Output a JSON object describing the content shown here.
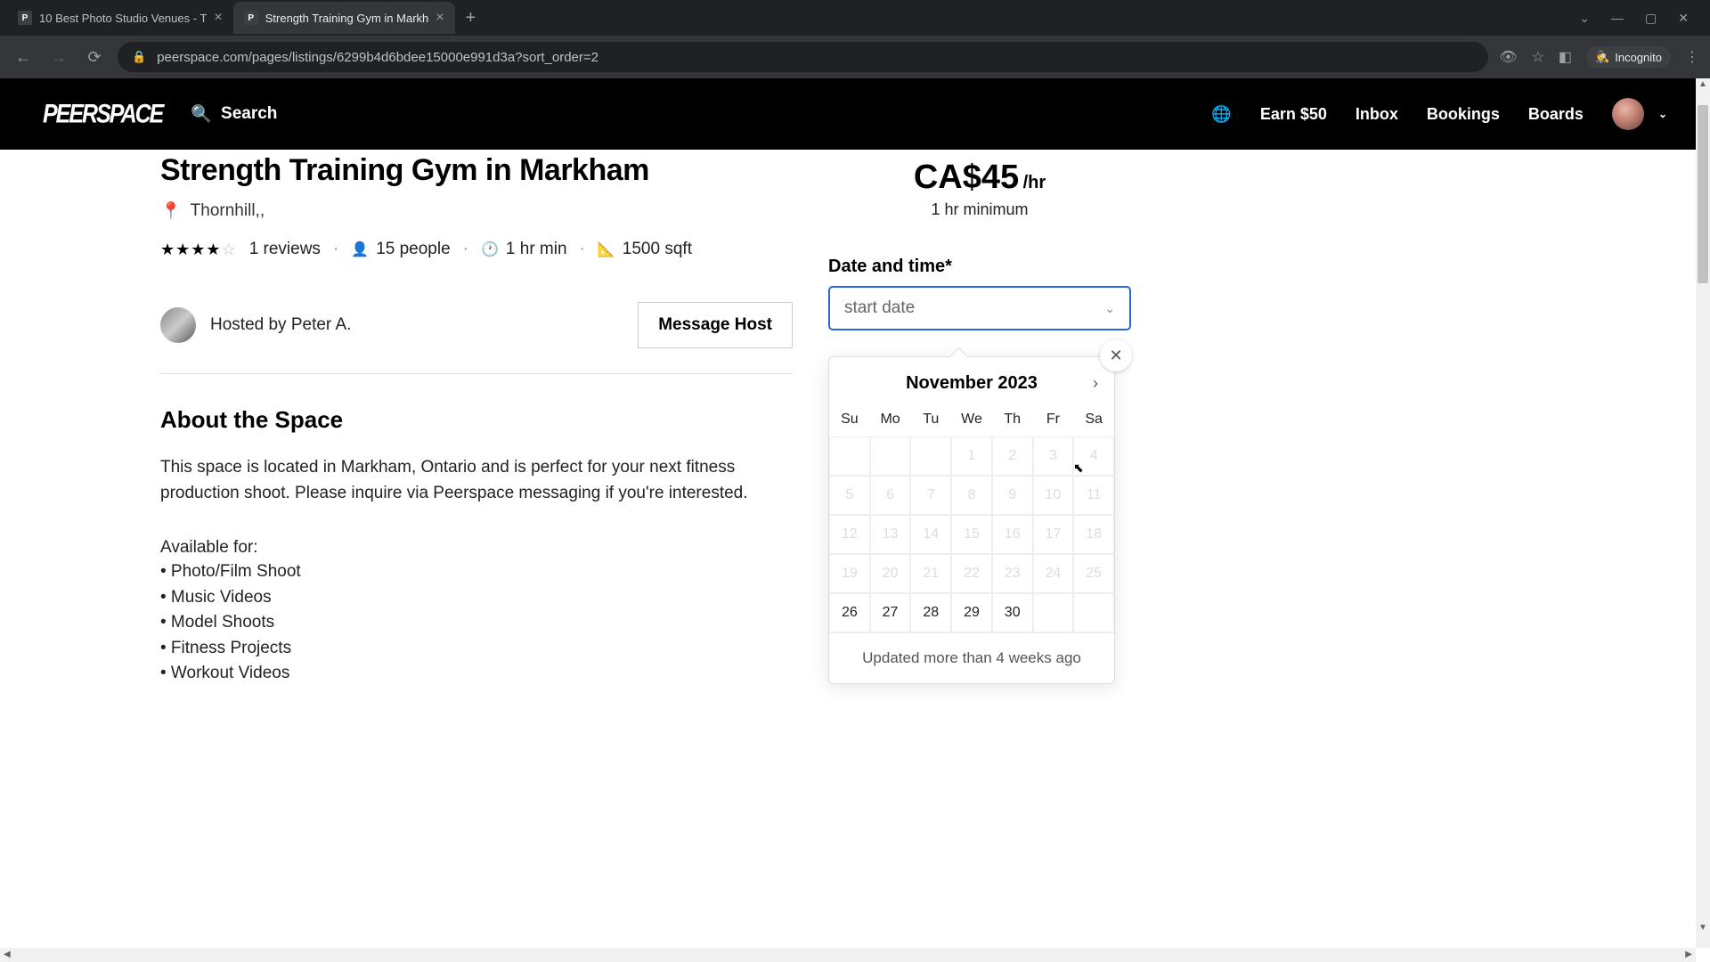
{
  "browser": {
    "tabs": [
      {
        "title": "10 Best Photo Studio Venues - T",
        "active": false
      },
      {
        "title": "Strength Training Gym in Markh",
        "active": true
      }
    ],
    "url": "peerspace.com/pages/listings/6299b4d6bdee15000e991d3a?sort_order=2",
    "incognito_label": "Incognito",
    "window_controls": {
      "minimize": "—",
      "maximize": "▢",
      "close": "✕",
      "dropdown": "⌄"
    }
  },
  "header": {
    "logo": "PEERSPACE",
    "search_label": "Search",
    "nav": {
      "earn": "Earn $50",
      "inbox": "Inbox",
      "bookings": "Bookings",
      "boards": "Boards"
    }
  },
  "listing": {
    "title": "Strength Training Gym in Markham",
    "location": "Thornhill,,",
    "reviews": "1 reviews",
    "capacity": "15 people",
    "min_duration": "1 hr min",
    "area": "1500 sqft",
    "host_label": "Hosted by Peter A.",
    "message_host": "Message Host",
    "about_heading": "About the Space",
    "about_body": "This space is located in Markham, Ontario and is perfect for your next fitness production shoot. Please inquire via Peerspace messaging if you're interested.",
    "available_label": "Available for:",
    "bullets": [
      "Photo/Film Shoot",
      "Music Videos",
      "Model Shoots",
      "Fitness Projects",
      "Workout Videos"
    ]
  },
  "booking": {
    "price": "CA$45",
    "price_unit": "/hr",
    "minimum": "1 hr minimum",
    "date_time_label": "Date and time*",
    "start_date_placeholder": "start date"
  },
  "calendar": {
    "month": "November 2023",
    "dow": [
      "Su",
      "Mo",
      "Tu",
      "We",
      "Th",
      "Fr",
      "Sa"
    ],
    "weeks": [
      [
        "",
        "",
        "",
        "1",
        "2",
        "3",
        "4"
      ],
      [
        "5",
        "6",
        "7",
        "8",
        "9",
        "10",
        "11"
      ],
      [
        "12",
        "13",
        "14",
        "15",
        "16",
        "17",
        "18"
      ],
      [
        "19",
        "20",
        "21",
        "22",
        "23",
        "24",
        "25"
      ],
      [
        "26",
        "27",
        "28",
        "29",
        "30",
        "",
        ""
      ]
    ],
    "disabled_until": 25,
    "footer": "Updated more than 4 weeks ago"
  }
}
